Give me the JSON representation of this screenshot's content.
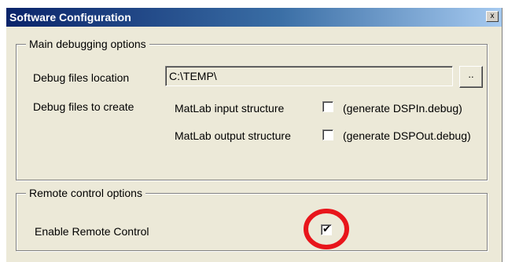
{
  "window": {
    "title": "Software Configuration",
    "close_label": "x"
  },
  "main_group": {
    "legend": "Main debugging options",
    "debug_location_label": "Debug files location",
    "debug_location_value": "C:\\TEMP\\",
    "browse_label": "..",
    "debug_create_label": "Debug files to create",
    "input_structure_label": "MatLab input structure",
    "input_structure_checked": false,
    "input_structure_hint": "(generate DSPIn.debug)",
    "output_structure_label": "MatLab output structure",
    "output_structure_checked": false,
    "output_structure_hint": "(generate DSPOut.debug)"
  },
  "remote_group": {
    "legend": "Remote control options",
    "enable_label": "Enable Remote Control",
    "enable_checked": true,
    "check_glyph": "✔"
  },
  "colors": {
    "dialog_bg": "#ece9d8",
    "title_gradient_start": "#0a246a",
    "title_gradient_end": "#a6caf0",
    "highlight_circle": "#e8151b"
  },
  "icons": {
    "close": "close-icon",
    "checkmark": "checkmark-icon"
  }
}
